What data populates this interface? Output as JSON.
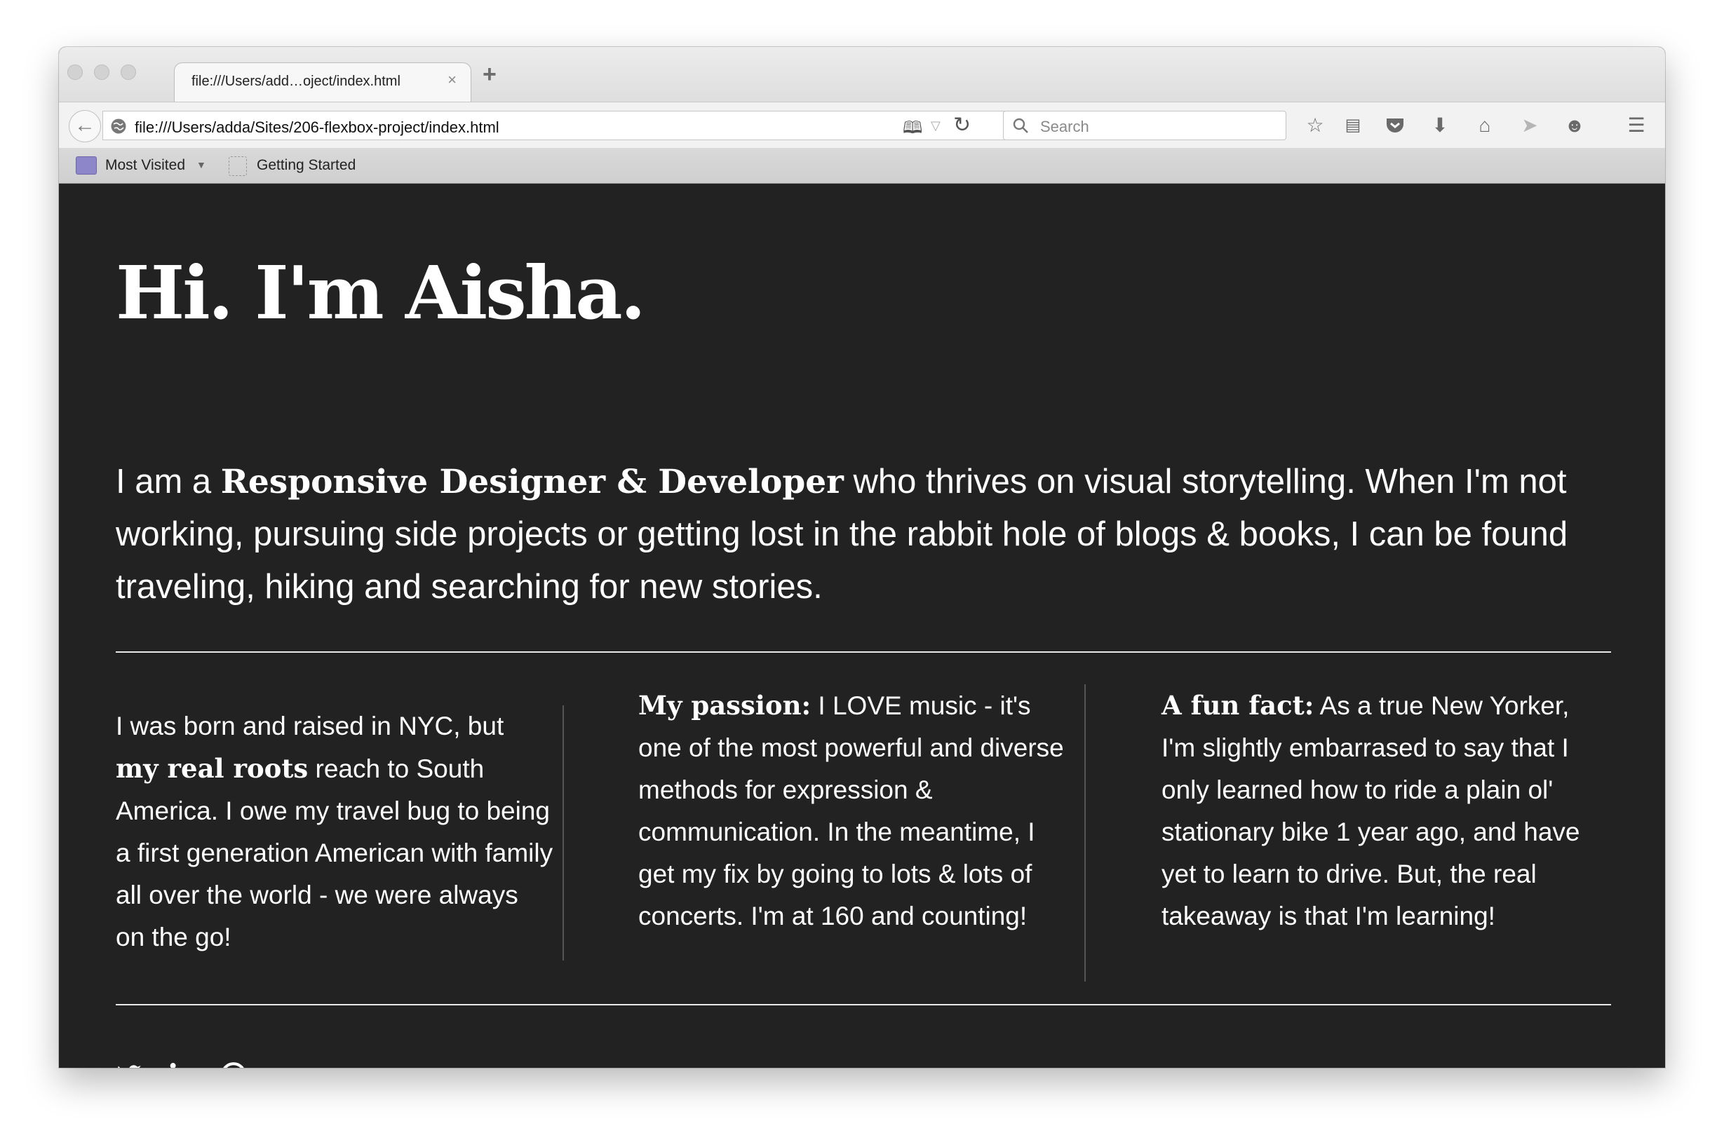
{
  "browser": {
    "tab": {
      "title": "file:///Users/add…oject/index.html",
      "close_glyph": "×"
    },
    "new_tab_glyph": "+",
    "url": "file:///Users/adda/Sites/206-flexbox-project/index.html",
    "search": {
      "placeholder": "Search",
      "value": ""
    },
    "bookmarks": [
      {
        "label": "Most Visited",
        "icon": "folder-icon",
        "has_dropdown": true
      },
      {
        "label": "Getting Started",
        "icon": "page-icon"
      }
    ],
    "toolbar_icons": [
      "star-icon",
      "reading-list-icon",
      "pocket-icon",
      "download-icon",
      "home-icon",
      "share-icon",
      "hello-icon",
      "menu-icon"
    ]
  },
  "page": {
    "heading": "Hi. I'm Aisha.",
    "intro": {
      "pre": "I am a ",
      "strong": "Responsive Designer & Developer",
      "post": " who thrives on visual storytelling. When I'm not working, pursuing side projects or getting lost in the rabbit hole of blogs & books, I can be found traveling, hiking and searching for new stories."
    },
    "columns": [
      {
        "pre": "I was born and raised in NYC, but ",
        "strong": "my real roots",
        "post": " reach to South America. I owe my travel bug to being a first generation American with family all over the world - we were always on the go!"
      },
      {
        "pre": "",
        "strong": "My passion:",
        "post": " I LOVE music - it's one of the most powerful and diverse methods for expression & communication. In the meantime, I get my fix by going to lots & lots of concerts. I'm at 160 and counting!"
      },
      {
        "pre": "",
        "strong": "A fun fact:",
        "post": " As a true New Yorker, I'm slightly embarrased to say that I only learned how to ride a plain ol' stationary bike 1 year ago, and have yet to learn to drive. But, the real takeaway is that I'm learning!"
      }
    ],
    "social_icons": [
      "twitter-icon",
      "linkedin-icon",
      "pinterest-icon"
    ]
  }
}
